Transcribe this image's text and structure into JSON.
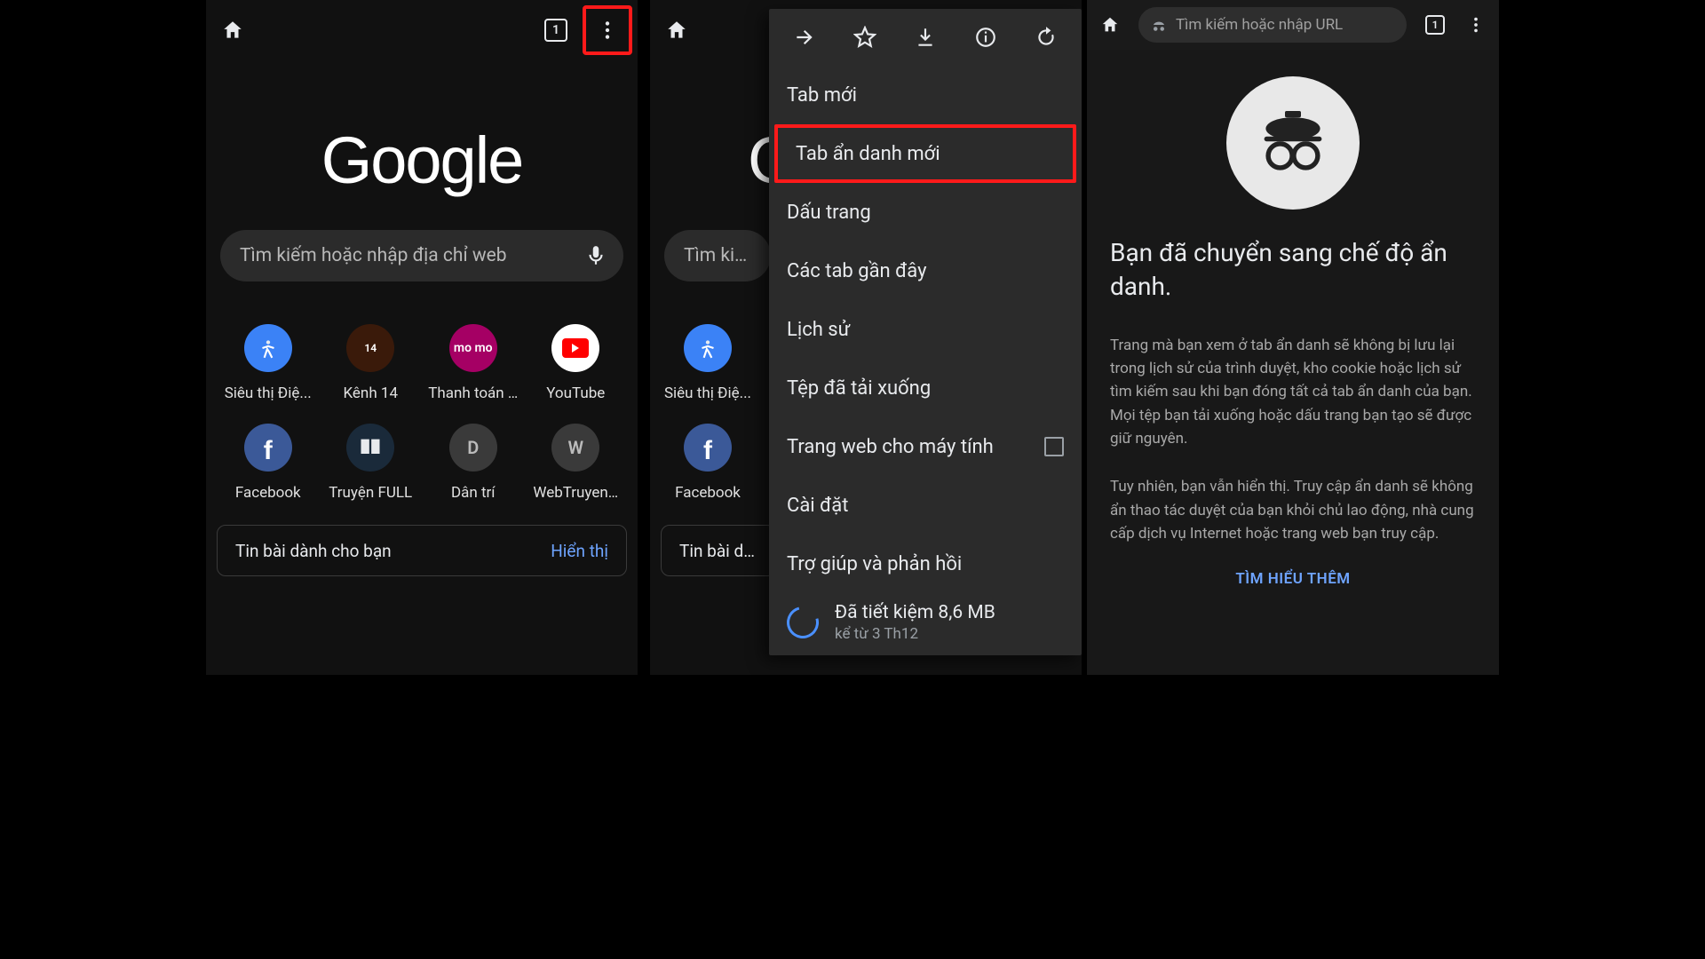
{
  "panel1": {
    "tab_count": "1",
    "logo": "Google",
    "search_placeholder": "Tìm kiếm hoặc nhập địa chỉ web",
    "shortcuts": [
      {
        "label": "Siêu thị Điệ...",
        "chip": "blue",
        "glyph": "✕"
      },
      {
        "label": "Kênh 14",
        "chip": "k14",
        "glyph": "14"
      },
      {
        "label": "Thanh toán …",
        "chip": "momo",
        "glyph": "mo\nmo"
      },
      {
        "label": "YouTube",
        "chip": "yt",
        "glyph": ""
      },
      {
        "label": "Facebook",
        "chip": "fb",
        "glyph": "f"
      },
      {
        "label": "Truyện FULL",
        "chip": "truyen",
        "glyph": "▦"
      },
      {
        "label": "Dân trí",
        "chip": "gray",
        "glyph": "D"
      },
      {
        "label": "WebTruyen…",
        "chip": "gray",
        "glyph": "W"
      }
    ],
    "for_you_label": "Tin bài dành cho bạn",
    "for_you_action": "Hiển thị"
  },
  "panel2": {
    "search_placeholder": "Tìm kiếm",
    "shortcuts": [
      {
        "label": "Siêu thị Điệ...",
        "chip": "blue",
        "glyph": "✕"
      },
      {
        "label": "Facebook",
        "chip": "fb",
        "glyph": "f"
      }
    ],
    "for_you_label": "Tin bài dành",
    "menu": {
      "items": [
        {
          "label": "Tab mới",
          "highlight": false
        },
        {
          "label": "Tab ẩn danh mới",
          "highlight": true
        },
        {
          "label": "Dấu trang",
          "highlight": false
        },
        {
          "label": "Các tab gần đây",
          "highlight": false
        },
        {
          "label": "Lịch sử",
          "highlight": false
        },
        {
          "label": "Tệp đã tải xuống",
          "highlight": false
        },
        {
          "label": "Trang web cho máy tính",
          "highlight": false,
          "checkbox": true
        },
        {
          "label": "Cài đặt",
          "highlight": false
        },
        {
          "label": "Trợ giúp và phản hồi",
          "highlight": false
        }
      ],
      "datasaver_line1": "Đã tiết kiệm 8,6 MB",
      "datasaver_line2": "kể từ 3 Th12"
    }
  },
  "panel3": {
    "url_placeholder": "Tìm kiếm hoặc nhập URL",
    "tab_count": "1",
    "heading": "Bạn đã chuyển sang chế độ ẩn danh.",
    "para1": "Trang mà bạn xem ở tab ẩn danh sẽ không bị lưu lại trong lịch sử của trình duyệt, kho cookie hoặc lịch sử tìm kiếm sau khi bạn đóng tất cả tab ẩn danh của bạn. Mọi tệp bạn tải xuống hoặc dấu trang bạn tạo sẽ được giữ nguyên.",
    "para2": "Tuy nhiên, bạn vẫn hiển thị. Truy cập ẩn danh sẽ không ẩn thao tác duyệt của bạn khỏi chủ lao động, nhà cung cấp dịch vụ Internet hoặc trang web bạn truy cập.",
    "learn_more": "TÌM HIỂU THÊM"
  }
}
